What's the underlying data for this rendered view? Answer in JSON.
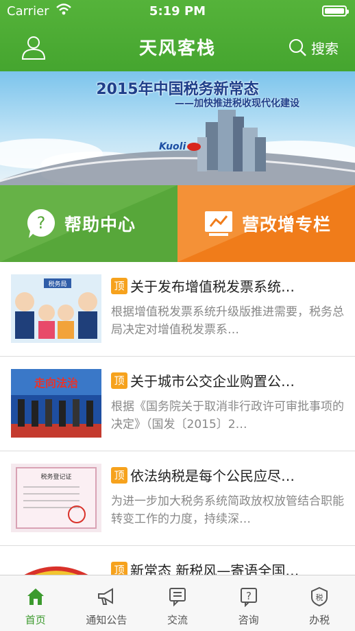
{
  "status_bar": {
    "carrier": "Carrier",
    "time": "5:19 PM"
  },
  "navbar": {
    "title": "天风客栈",
    "search_label": "搜索",
    "user_icon": "user-icon",
    "search_icon": "search-icon"
  },
  "banner": {
    "title": "2015年中国税务新常态",
    "subtitle": "——加快推进税收现代化建设",
    "brand": "Kuoli"
  },
  "tiles": [
    {
      "label": "帮助中心",
      "icon": "help-bubble-icon",
      "color": "#57a73a"
    },
    {
      "label": "营改增专栏",
      "icon": "chart-board-icon",
      "color": "#f07c1a"
    }
  ],
  "news": [
    {
      "badge": "顶",
      "title": "关于发布增值税发票系统…",
      "desc": "根据增值税发票系统升级版推进需要，税务总局决定对增值税发票系…"
    },
    {
      "badge": "顶",
      "title": "关于城市公交企业购置公…",
      "desc": "根据《国务院关于取消非行政许可审批事项的决定》（国发〔2015〕2…"
    },
    {
      "badge": "顶",
      "title": "依法纳税是每个公民应尽…",
      "desc": "为进一步加大税务系统简政放权放管结合职能转变工作的力度，持续深…"
    },
    {
      "badge": "顶",
      "title": "新常态 新税风—寄语全国…",
      "desc": ""
    }
  ],
  "thumbs": {
    "tax_bureau_sign": "税务局",
    "certificate_title": "税务登记证",
    "law_banner": "走向法治"
  },
  "tabbar": [
    {
      "label": "首页",
      "icon": "home-icon",
      "active": true
    },
    {
      "label": "通知公告",
      "icon": "megaphone-icon",
      "active": false
    },
    {
      "label": "交流",
      "icon": "chat-icon",
      "active": false
    },
    {
      "label": "咨询",
      "icon": "question-icon",
      "active": false
    },
    {
      "label": "办税",
      "icon": "tax-badge-icon",
      "active": false
    }
  ],
  "colors": {
    "header_green": "#4aab33",
    "accent_orange": "#f07c1a",
    "badge_orange": "#f6a21d",
    "tab_active": "#3c9a2e"
  }
}
